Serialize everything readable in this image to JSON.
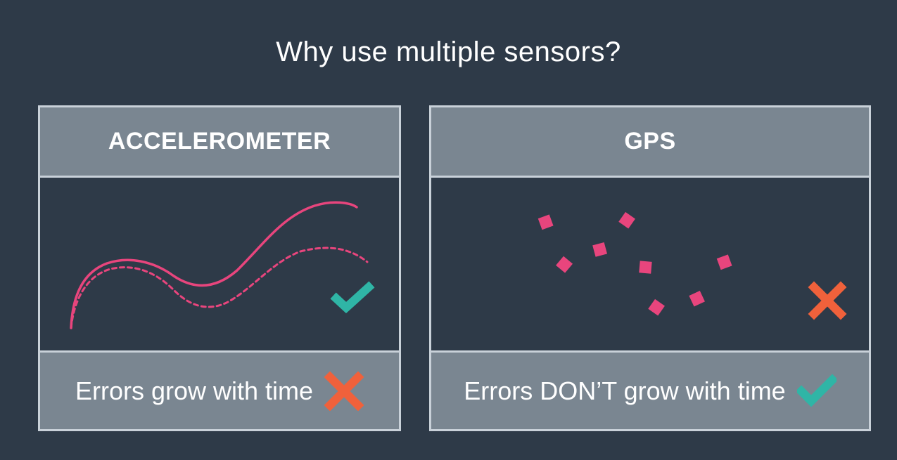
{
  "title": "Why use multiple sensors?",
  "colors": {
    "background": "#2e3a48",
    "panel": "#7a8691",
    "border": "#c9d1d9",
    "pink": "#e8457d",
    "teal": "#2fb5a6",
    "orange": "#f0613b"
  },
  "panels": [
    {
      "header": "ACCELEROMETER",
      "footer": "Errors grow with time",
      "body_icon": "check-icon",
      "footer_icon": "cross-icon"
    },
    {
      "header": "GPS",
      "footer": "Errors DON’T grow with time",
      "body_icon": "cross-icon",
      "footer_icon": "check-icon"
    }
  ]
}
